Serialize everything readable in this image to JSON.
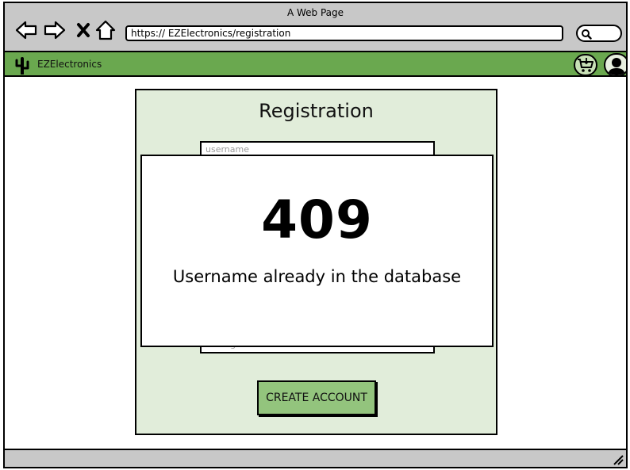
{
  "window": {
    "title": "A Web Page"
  },
  "browser": {
    "url": "https:// EZElectronics/registration",
    "icons": [
      "back-arrow-icon",
      "forward-arrow-icon",
      "close-icon",
      "home-icon",
      "search-icon"
    ]
  },
  "app": {
    "name": "EZElectronics",
    "accent_color": "#6aa84f",
    "icons": [
      "cactus-logo-icon",
      "cart-icon",
      "user-profile-icon"
    ]
  },
  "registration": {
    "title": "Registration",
    "username_placeholder": "username",
    "role_placeholder": "manager",
    "create_button_label": "CREATE ACCOUNT",
    "panel_color": "#e1edda",
    "button_color": "#93c47d"
  },
  "error_modal": {
    "code": "409",
    "message": "Username already in the database"
  }
}
